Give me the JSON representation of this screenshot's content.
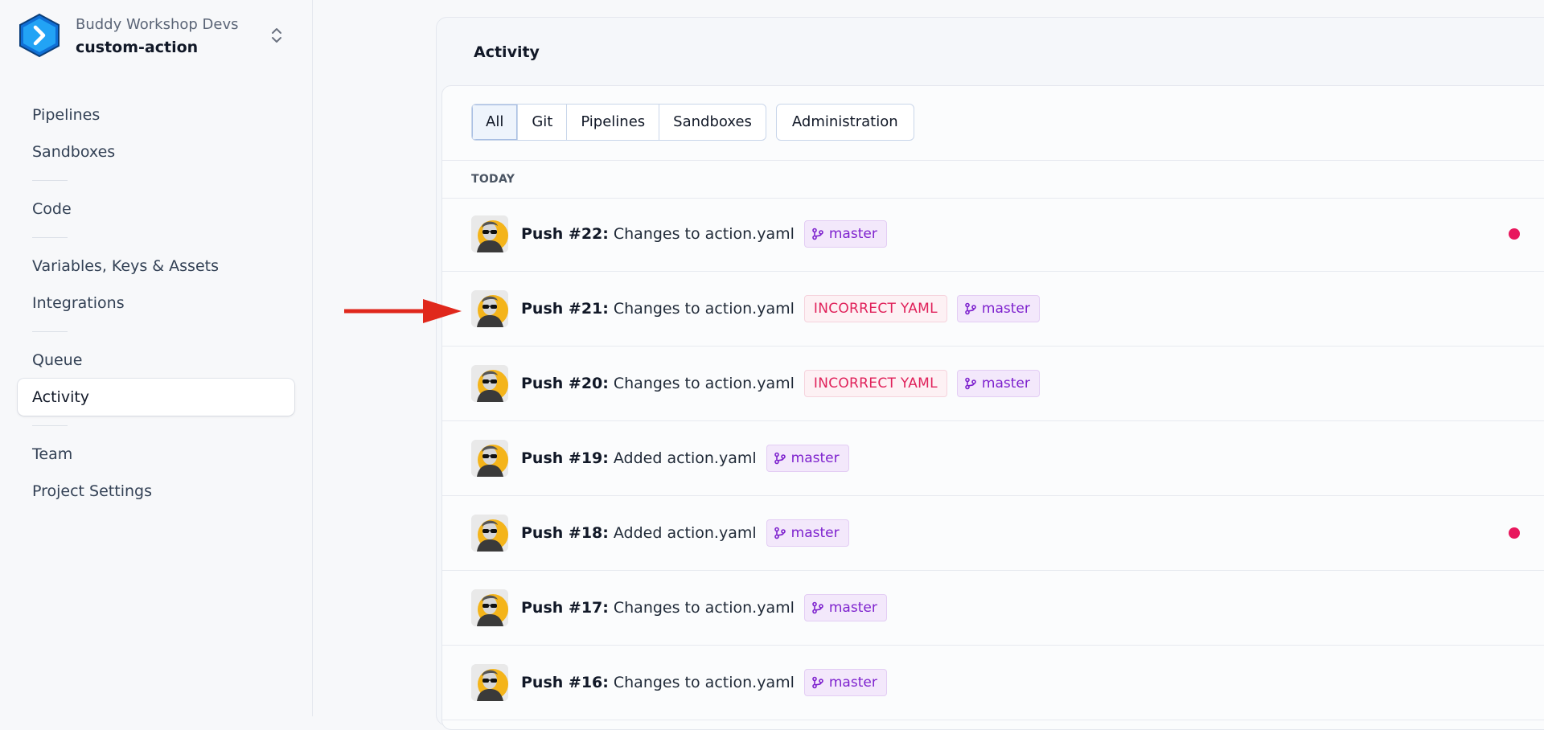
{
  "workspace": {
    "org_name": "Buddy Workshop Devs",
    "project_name": "custom-action"
  },
  "sidebar": {
    "groups": [
      [
        "Pipelines",
        "Sandboxes"
      ],
      [
        "Code"
      ],
      [
        "Variables, Keys & Assets",
        "Integrations"
      ],
      [
        "Queue",
        "Activity"
      ],
      [
        "Team",
        "Project Settings"
      ]
    ],
    "active": "Activity"
  },
  "main": {
    "title": "Activity",
    "filters": [
      "All",
      "Git",
      "Pipelines",
      "Sandboxes"
    ],
    "active_filter": "All",
    "admin_button": "Administration",
    "section_label": "TODAY",
    "activities": [
      {
        "number": "Push #22:",
        "message": "Changes to action.yaml",
        "error": "",
        "branch": "master",
        "unread": true
      },
      {
        "number": "Push #21:",
        "message": "Changes to action.yaml",
        "error": "INCORRECT YAML",
        "branch": "master",
        "unread": false
      },
      {
        "number": "Push #20:",
        "message": "Changes to action.yaml",
        "error": "INCORRECT YAML",
        "branch": "master",
        "unread": false
      },
      {
        "number": "Push #19:",
        "message": "Added action.yaml",
        "error": "",
        "branch": "master",
        "unread": false
      },
      {
        "number": "Push #18:",
        "message": "Added action.yaml",
        "error": "",
        "branch": "master",
        "unread": true
      },
      {
        "number": "Push #17:",
        "message": "Changes to action.yaml",
        "error": "",
        "branch": "master",
        "unread": false
      },
      {
        "number": "Push #16:",
        "message": "Changes to action.yaml",
        "error": "",
        "branch": "master",
        "unread": false
      }
    ]
  },
  "icons": {
    "logo": "buddy-logo-icon",
    "switcher": "chevron-up-down-icon",
    "branch": "git-branch-icon",
    "unread": "unread-dot-icon",
    "annotation": "red-arrow-icon"
  },
  "colors": {
    "accent_blue": "#1a8ff2",
    "error_text": "#e0215a",
    "branch_text": "#7e22ce",
    "unread_dot": "#e8175d",
    "arrow": "#e0281c"
  }
}
